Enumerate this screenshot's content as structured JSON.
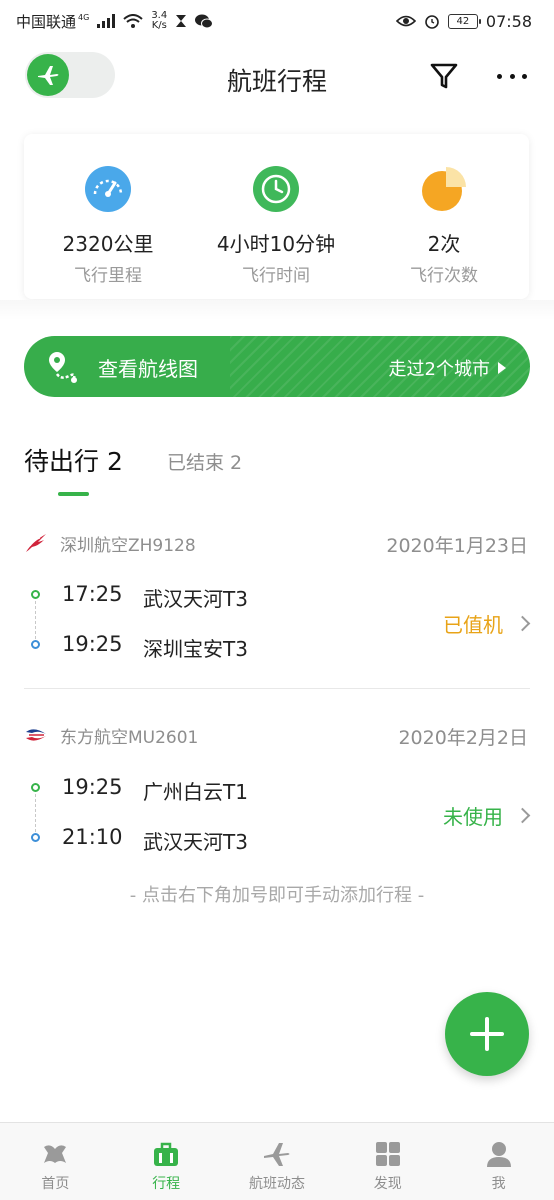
{
  "status_bar": {
    "carrier": "中国联通",
    "network": "4G",
    "speed_value": "3.4",
    "speed_unit": "K/s",
    "battery": "42",
    "time": "07:58"
  },
  "header": {
    "title": "航班行程",
    "toggle_icon": "airplane-icon",
    "filter_icon": "filter-icon",
    "more_icon": "more-icon"
  },
  "stats": [
    {
      "value": "2320公里",
      "label": "飞行里程",
      "icon": "speedometer-icon",
      "color": "#4aa8ea"
    },
    {
      "value": "4小时10分钟",
      "label": "飞行时间",
      "icon": "clock-icon",
      "color": "#3fb85a"
    },
    {
      "value": "2次",
      "label": "飞行次数",
      "icon": "pie-chart-icon",
      "color": "#f5a623"
    }
  ],
  "route_banner": {
    "label": "查看航线图",
    "cities": "走过2个城市"
  },
  "tabs": {
    "active": "待出行 2",
    "inactive": "已结束 2"
  },
  "flights": [
    {
      "airline": "深圳航空ZH9128",
      "date": "2020年1月23日",
      "depart_time": "17:25",
      "depart_airport": "武汉天河T3",
      "arrive_time": "19:25",
      "arrive_airport": "深圳宝安T3",
      "status": "已值机",
      "status_color": "#e8a317"
    },
    {
      "airline": "东方航空MU2601",
      "date": "2020年2月2日",
      "depart_time": "19:25",
      "depart_airport": "广州白云T1",
      "arrive_time": "21:10",
      "arrive_airport": "武汉天河T3",
      "status": "未使用",
      "status_color": "#37b34a"
    }
  ],
  "hint": "- 点击右下角加号即可手动添加行程 -",
  "nav": [
    {
      "label": "首页",
      "icon": "home-icon"
    },
    {
      "label": "行程",
      "icon": "luggage-icon",
      "active": true
    },
    {
      "label": "航班动态",
      "icon": "plane-icon"
    },
    {
      "label": "发现",
      "icon": "grid-icon"
    },
    {
      "label": "我",
      "icon": "user-icon"
    }
  ],
  "colors": {
    "accent": "#37b34a",
    "text_secondary": "#8e8e8e"
  }
}
